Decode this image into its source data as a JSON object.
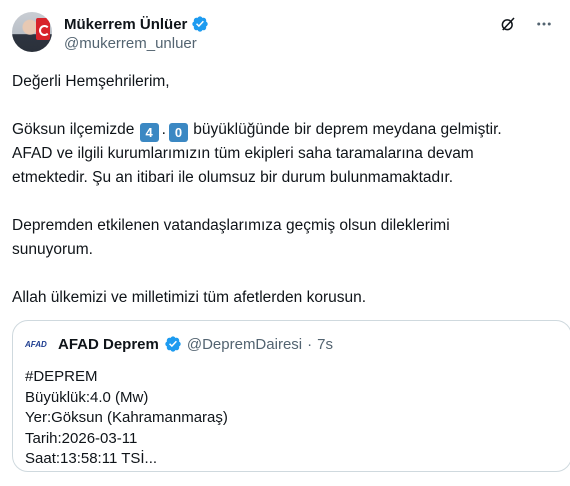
{
  "author": {
    "display_name": "Mükerrem Ünlüer",
    "handle": "@mukerrem_unluer"
  },
  "colors": {
    "verified": "#1d9bf0",
    "keycap": "#3b88c3",
    "muted": "#536471",
    "border": "#cfd9de"
  },
  "icons": {
    "grok": "grok-icon",
    "more": "more-icon"
  },
  "post": {
    "greeting": "Değerli Hemşehrilerim,",
    "p1_before": "Göksun ilçemizde",
    "magnitude_digit1": "4",
    "magnitude_dot": ".",
    "magnitude_digit2": "0",
    "p1_after": "büyüklüğünde bir deprem meydana gelmiştir.",
    "p1_line2": "AFAD ve ilgili kurumlarımızın tüm ekipleri saha taramalarına devam",
    "p1_line3": "etmektedir. Şu an itibari ile olumsuz bir durum bulunmamaktadır.",
    "p2_line1": "Depremden etkilenen vatandaşlarımıza geçmiş olsun dileklerimi",
    "p2_line2": "sunuyorum.",
    "p3": "Allah ülkemizi ve milletimizi tüm afetlerden korusun."
  },
  "quote": {
    "logo_text": "AFAD",
    "display_name": "AFAD Deprem",
    "handle": "@DepremDairesi",
    "separator": "·",
    "time": "7s",
    "lines": [
      "#DEPREM",
      "Büyüklük:4.0 (Mw)",
      "Yer:Göksun (Kahramanmaraş)",
      "Tarih:2026-03-11",
      "Saat:13:58:11 TSİ..."
    ]
  }
}
